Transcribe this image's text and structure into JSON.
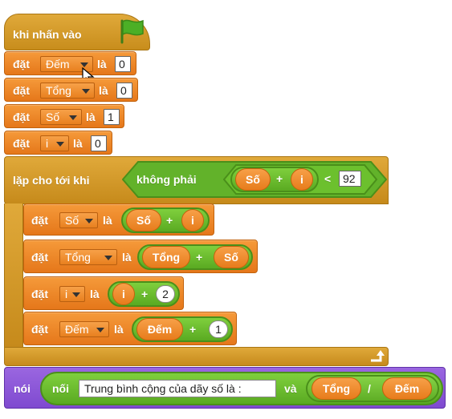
{
  "hat": {
    "label": "khi nhấn vào",
    "icon": "green-flag-icon"
  },
  "set_label": "đặt",
  "to_label": "là",
  "top_sets": [
    {
      "var": "Đếm",
      "value": "0"
    },
    {
      "var": "Tổng",
      "value": "0"
    },
    {
      "var": "Số",
      "value": "1"
    },
    {
      "var": "i",
      "value": "0"
    }
  ],
  "loop": {
    "label": "lặp cho tới khi",
    "not_label": "không phải",
    "cond": {
      "left_a": "Số",
      "plus": "+",
      "left_b": "i",
      "op": "<",
      "right": "92"
    },
    "body": [
      {
        "var": "Số",
        "expr_a": "Số",
        "op": "+",
        "expr_b": "i"
      },
      {
        "var": "Tổng",
        "expr_a": "Tổng",
        "op": "+",
        "expr_b": "Số"
      },
      {
        "var": "i",
        "expr_a": "i",
        "op": "+",
        "expr_b": "2"
      },
      {
        "var": "Đếm",
        "expr_a": "Đếm",
        "op": "+",
        "expr_b": "1"
      }
    ],
    "repeat_icon": "loop-arrow-icon"
  },
  "say": {
    "label": "nói",
    "join_label": "nối",
    "text": "Trung bình cộng của dãy số là :",
    "and_label": "và",
    "div_a": "Tổng",
    "div_op": "/",
    "div_b": "Đếm"
  },
  "colors": {
    "events": "#d6a02d",
    "data": "#ee8a2a",
    "operators": "#62b22a",
    "looks": "#8a55d7"
  }
}
